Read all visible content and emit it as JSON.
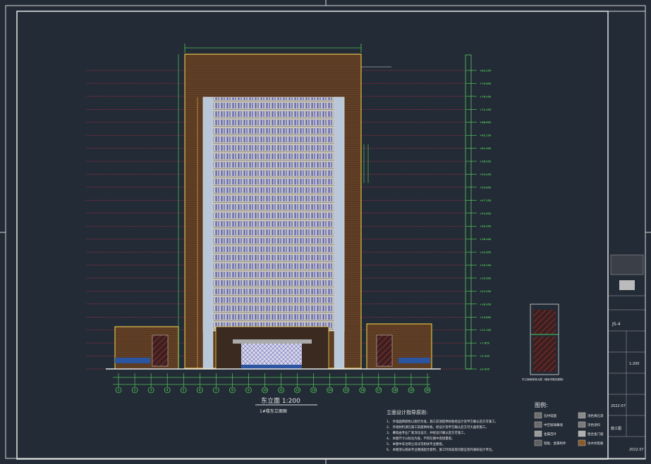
{
  "drawing": {
    "scale_label": "东立面  1:200",
    "subtitle": "1#楼东立面图",
    "notes_title": "立面设计指导原则:",
    "notes": [
      "1、 外墙面砖颜色以图示为准，施工前须提供样板经设计及甲方确认后方可施工。",
      "2、 外墙材料须在施工前提供样板，经设计及甲方确认后方可大面积施工。",
      "3、 幕墙由专业厂家深化设计，并经设计确认后方可施工。",
      "4、 本图尺寸以标注为准，不得在图中直接量取。",
      "5、 本图中未注明之处详见相关专业图纸。",
      "6、 本图须与相关专业图纸配合使用，施工时如发现问题应及时通知设计单位。"
    ],
    "legend_title": "图例:",
    "legend": [
      {
        "label": "石材墙面",
        "color": "#6e6e6e"
      },
      {
        "label": "浅色真石漆",
        "color": "#8a8a8a"
      },
      {
        "label": "中空玻璃幕墙",
        "color": "#6a6a6a"
      },
      {
        "label": "深色涂料",
        "color": "#7a7a7a"
      },
      {
        "label": "金属百叶",
        "color": "#9a9a9a"
      },
      {
        "label": "铝合金门窗",
        "color": "#b0b0b0"
      },
      {
        "label": "铝板、金属构件",
        "color": "#5e5e5e"
      },
      {
        "label": "仿木纹铝板",
        "color": "#8b5a2b"
      }
    ],
    "grid_labels": [
      "1",
      "2",
      "3",
      "4",
      "5",
      "6",
      "7",
      "8",
      "9",
      "10",
      "11",
      "12",
      "13",
      "14",
      "15",
      "16",
      "17",
      "18",
      "19",
      "20"
    ],
    "elevations": [
      "+83.250",
      "+79.650",
      "+76.050",
      "+72.450",
      "+68.850",
      "+65.250",
      "+61.650",
      "+58.050",
      "+54.450",
      "+50.850",
      "+47.250",
      "+43.650",
      "+40.050",
      "+36.450",
      "+32.850",
      "+29.250",
      "+25.650",
      "+22.050",
      "+18.450",
      "+14.850",
      "+11.250",
      "+7.650",
      "+4.500",
      "±0.000"
    ],
    "detail_caption": "东立面局部放大图（墙身详图见建施）",
    "title_block": {
      "project_code": "2022-07",
      "sheet_no": "JS-4",
      "ratio": "1:200",
      "stage": "施工图",
      "date": "2022.07"
    }
  }
}
